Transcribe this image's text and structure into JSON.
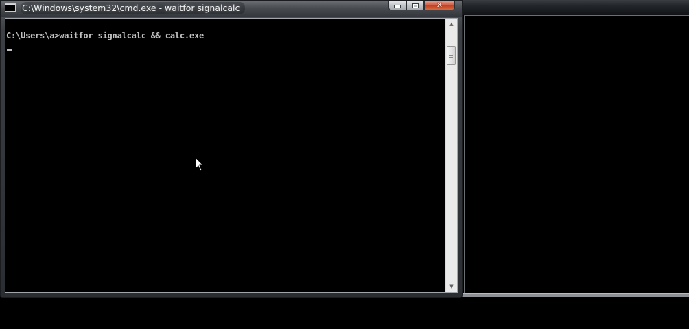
{
  "window": {
    "title": "C:\\Windows\\system32\\cmd.exe - waitfor  signalcalc",
    "icon": "cmd-icon",
    "controls": {
      "minimize": "minimize-icon",
      "maximize": "maximize-icon",
      "close": "close-icon"
    }
  },
  "console": {
    "lines": [
      "C:\\Users\\a>waitfor signalcalc && calc.exe"
    ],
    "text_color": "#c0c0c0",
    "background": "#000000"
  },
  "scrollbar": {
    "up_arrow": "up-arrow-icon",
    "down_arrow": "down-arrow-icon"
  },
  "pointer": {
    "icon": "mouse-pointer-icon"
  },
  "colors": {
    "close_button": "#c24125",
    "titlebar": "#3c4045"
  }
}
